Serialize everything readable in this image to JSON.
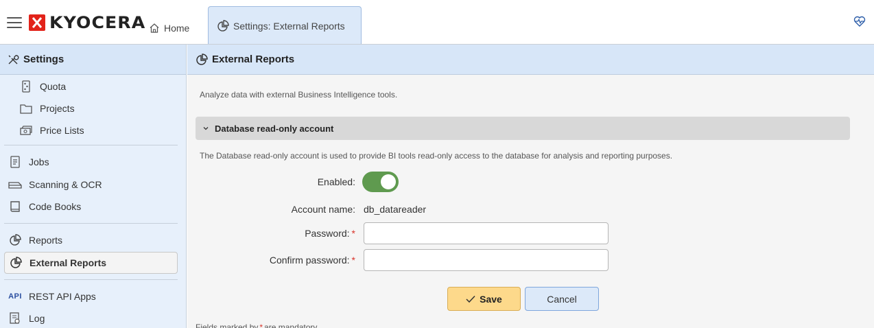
{
  "brand": {
    "name": "KYOCERA",
    "color": "#e2231a"
  },
  "tabs": [
    {
      "label": "Home",
      "icon": "home-icon"
    },
    {
      "label": "Settings: External Reports",
      "icon": "pie-chart-icon"
    }
  ],
  "top_right_icon": "pulse-heart-icon",
  "sidebar": {
    "title": "Settings",
    "items": [
      {
        "label": "Quota",
        "icon": "quota-icon"
      },
      {
        "label": "Projects",
        "icon": "folder-icon"
      },
      {
        "label": "Price Lists",
        "icon": "price-list-icon"
      },
      {
        "label": "Jobs",
        "icon": "document-icon"
      },
      {
        "label": "Scanning & OCR",
        "icon": "scanner-icon"
      },
      {
        "label": "Code Books",
        "icon": "book-icon"
      },
      {
        "label": "Reports",
        "icon": "pie-chart-icon"
      },
      {
        "label": "External Reports",
        "icon": "pie-chart-icon",
        "active": true
      },
      {
        "label": "REST API Apps",
        "icon": "api-icon",
        "badge": "API"
      },
      {
        "label": "Log",
        "icon": "log-icon"
      }
    ]
  },
  "main": {
    "title": "External Reports",
    "description": "Analyze data with external Business Intelligence tools.",
    "section": {
      "title": "Database read-only account",
      "expanded": true,
      "description": "The Database read-only account is used to provide BI tools read-only access to the database for analysis and reporting purposes."
    },
    "form": {
      "enabled_label": "Enabled:",
      "enabled": true,
      "account_name_label": "Account name:",
      "account_name_value": "db_datareader",
      "password_label": "Password:",
      "password_value": "",
      "confirm_password_label": "Confirm password:",
      "confirm_password_value": "",
      "required_marker": "*"
    },
    "buttons": {
      "save": "Save",
      "cancel": "Cancel"
    },
    "footnote_before": "Fields marked by",
    "footnote_after": "are mandatory."
  },
  "colors": {
    "header_blue": "#d7e6f8",
    "toggle_on": "#5f9a4f",
    "save_button": "#fdd98b",
    "required": "#d9342b"
  }
}
